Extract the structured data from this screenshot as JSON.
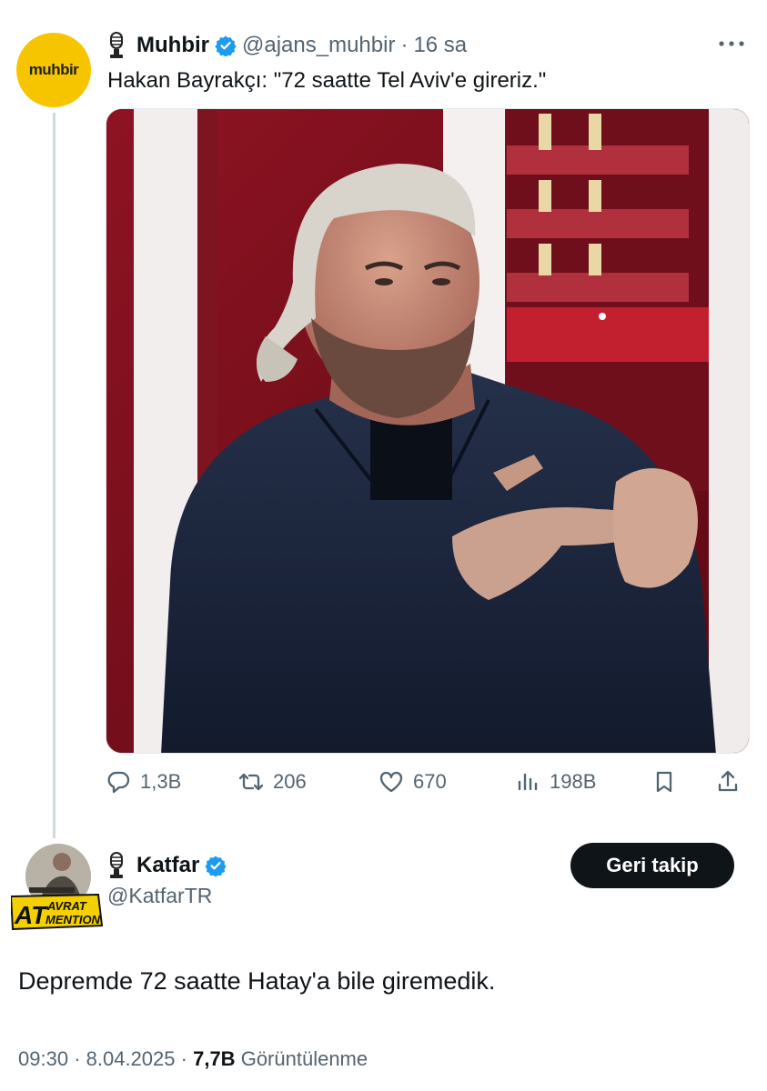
{
  "quoted_tweet": {
    "avatar_text": "muhbir",
    "author_name": "Muhbir",
    "author_handle": "@ajans_muhbir",
    "separator": "·",
    "time_ago": "16 sa",
    "text": "Hakan Bayrakçı: \"72 saatte Tel Aviv'e gireriz.\"",
    "stats": {
      "replies": "1,3B",
      "retweets": "206",
      "likes": "670",
      "views": "198B"
    }
  },
  "reply_tweet": {
    "author_name": "Katfar",
    "author_handle": "@KatfarTR",
    "avatar_badge_line1": "AT",
    "avatar_badge_line2": "AVRAT",
    "avatar_badge_line3": "MENTION",
    "follow_button_label": "Geri takip",
    "text": "Depremde 72 saatte Hatay'a bile giremedik.",
    "time": "09:30",
    "date": "8.04.2025",
    "views_count": "7,7B",
    "views_label": "Görüntülenme"
  },
  "colors": {
    "verified_blue": "#1d9bf0",
    "muhbir_yellow": "#f7c500",
    "secondary_text": "#536471",
    "follow_button_bg": "#0f1419"
  }
}
